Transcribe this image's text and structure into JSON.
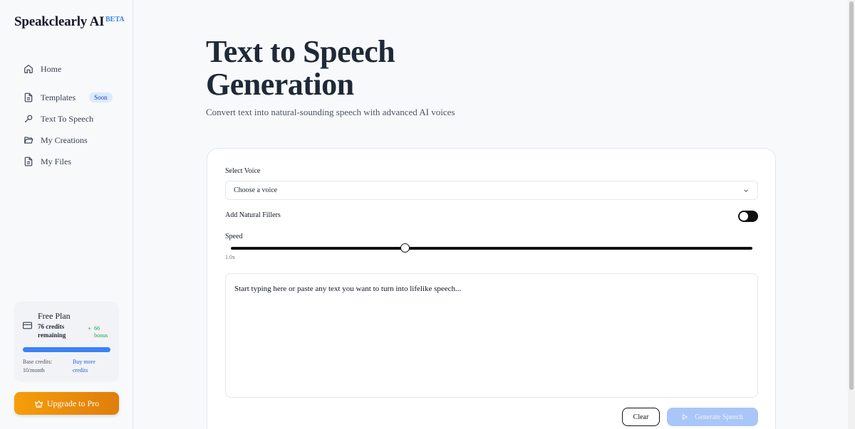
{
  "app": {
    "name": "Speakclearly AI",
    "badge": "BETA"
  },
  "sidebar": {
    "items": [
      {
        "label": "Home",
        "icon": "home-icon"
      },
      {
        "label": "Templates",
        "icon": "document-icon",
        "badge": "Soon"
      },
      {
        "label": "Text To Speech",
        "icon": "microphone-icon"
      },
      {
        "label": "My Creations",
        "icon": "folder-open-icon"
      },
      {
        "label": "My Files",
        "icon": "file-icon"
      }
    ]
  },
  "plan": {
    "title": "Free Plan",
    "credits": "76 credits remaining",
    "bonus_plus": "+",
    "bonus": "66 bonus",
    "progress": 1.0,
    "base_credits": "Base credits: 10/month",
    "buy_more": "Buy more credits"
  },
  "upgrade": {
    "label": "Upgrade to Pro",
    "icon": "crown-icon"
  },
  "main": {
    "title": "Text to Speech Generation",
    "subtitle": "Convert text into natural-sounding speech with advanced AI voices"
  },
  "form": {
    "voice_label": "Select Voice",
    "voice_value": "Choose a voice",
    "fillers_label": "Add Natural Fillers",
    "fillers_enabled": false,
    "speed_label": "Speed",
    "speed_value": "1.0x",
    "speed_position": 0.3333,
    "text_placeholder": "Start typing here or paste any text you want to turn into lifelike speech...",
    "clear_label": "Clear",
    "generate_label": "Generate Speech"
  },
  "colors": {
    "accent": "#3b82f6",
    "upgrade": "#f59e0b",
    "generate_disabled": "#a9c6f8"
  }
}
